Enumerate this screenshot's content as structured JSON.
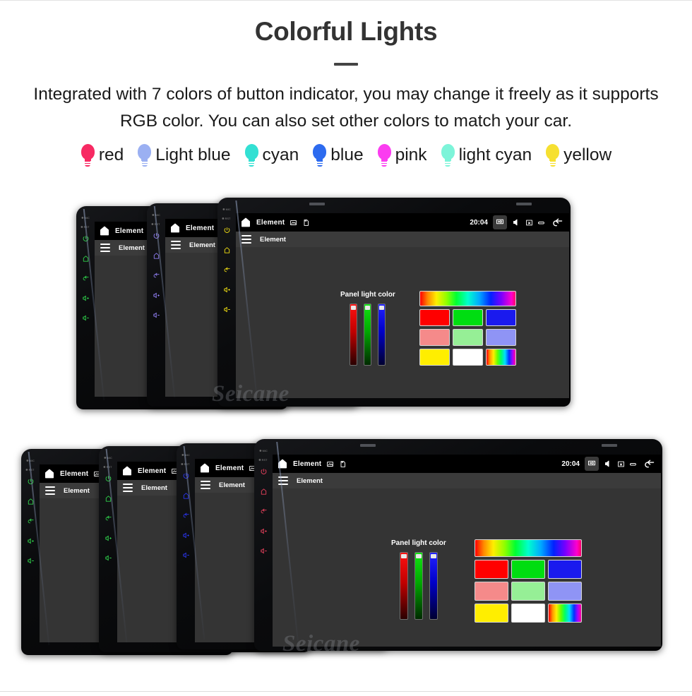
{
  "header": {
    "title": "Colorful Lights",
    "subtitle": "Integrated with 7 colors of button indicator, you may change it freely as it supports RGB color. You can also set other colors to match your car."
  },
  "legend": {
    "items": [
      {
        "label": "red",
        "color": "#f72a63"
      },
      {
        "label": "Light blue",
        "color": "#9bb0f2"
      },
      {
        "label": "cyan",
        "color": "#33e0d3"
      },
      {
        "label": "blue",
        "color": "#2d6bef"
      },
      {
        "label": "pink",
        "color": "#fb3df0"
      },
      {
        "label": "light cyan",
        "color": "#7df4d9"
      },
      {
        "label": "yellow",
        "color": "#f6e031"
      }
    ]
  },
  "device": {
    "statusbar": {
      "home_icon": "home-icon",
      "title": "Element",
      "picture_icon": "picture-icon",
      "sdcard_icon": "sdcard-icon",
      "clock": "20:04",
      "screenshot_icon": "screenshot-icon",
      "mute_icon": "mute-speaker-icon",
      "close_screen_icon": "close-screen-icon",
      "eject_icon": "eject-icon",
      "back_icon": "back-arrow-icon"
    },
    "appbar": {
      "menu_icon": "hamburger-menu-icon",
      "title": "Element"
    },
    "rail": {
      "mic_label": "MIC",
      "rst_label": "RST",
      "buttons": [
        "power-icon",
        "home-icon",
        "back-icon",
        "volume-up-icon",
        "volume-down-icon"
      ]
    },
    "panel": {
      "label": "Panel light color",
      "sliders": [
        {
          "name": "red-slider",
          "value": 100
        },
        {
          "name": "green-slider",
          "value": 100
        },
        {
          "name": "blue-slider",
          "value": 100
        }
      ],
      "swatches": [
        {
          "name": "rainbow-gradient-swatch",
          "color": "rainbow"
        },
        {
          "name": "red-swatch",
          "color": "#ff0000"
        },
        {
          "name": "green-swatch",
          "color": "#00dd11"
        },
        {
          "name": "blue-swatch",
          "color": "#1a1aee"
        },
        {
          "name": "salmon-swatch",
          "color": "#f58a8a"
        },
        {
          "name": "light-green-swatch",
          "color": "#96ef96"
        },
        {
          "name": "periwinkle-swatch",
          "color": "#8f94f5"
        },
        {
          "name": "yellow-swatch",
          "color": "#ffee00"
        },
        {
          "name": "white-swatch",
          "color": "#ffffff"
        },
        {
          "name": "rainbow-small-swatch",
          "color": "rainbow"
        }
      ]
    }
  },
  "clusters": [
    {
      "name": "cluster-top",
      "watermark": "Seicane",
      "units": [
        {
          "name": "unit-green",
          "led_color": "#2fd14a"
        },
        {
          "name": "unit-purple",
          "led_color": "#8e7df0"
        },
        {
          "name": "unit-yellow",
          "led_color": "#f2e012"
        }
      ]
    },
    {
      "name": "cluster-bottom",
      "watermark": "Seicane",
      "units": [
        {
          "name": "unit-green-1",
          "led_color": "#2fd14a"
        },
        {
          "name": "unit-green-2",
          "led_color": "#2fd14a"
        },
        {
          "name": "unit-blue",
          "led_color": "#2a35f0"
        },
        {
          "name": "unit-red",
          "led_color": "#e8405c"
        }
      ]
    }
  ]
}
